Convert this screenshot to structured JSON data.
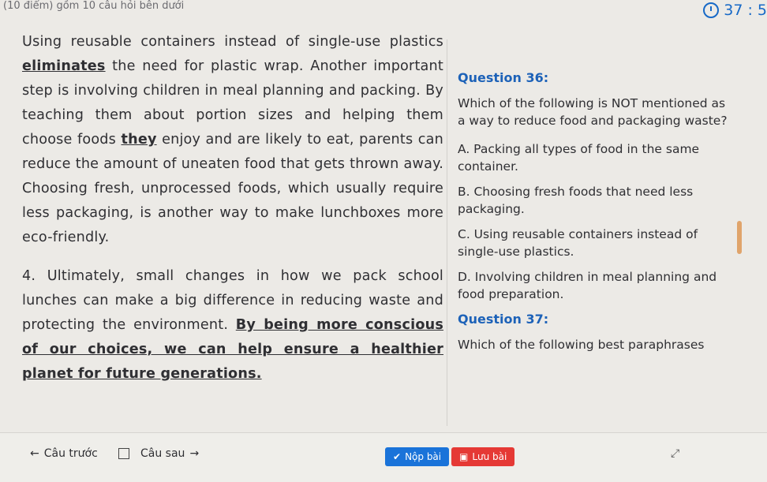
{
  "header": {
    "hint": "(10 điểm) gồm 10 câu hỏi bên dưới",
    "timer": "37 : 5"
  },
  "passage": {
    "p1_a": "Using reusable containers instead of single-use plastics ",
    "p1_u1": "eliminates",
    "p1_b": " the need for plastic wrap. Another important step is involving children in meal planning and packing. By teaching them about portion sizes and helping them choose foods ",
    "p1_u2": "they",
    "p1_c": " enjoy and are likely to eat, parents can reduce the amount of uneaten food that gets thrown away. Choosing fresh, unprocessed foods, which usually require less packaging, is another way to make lunchboxes more eco-friendly.",
    "p2_a": "4. Ultimately, small changes in how we pack school lunches can make a big difference in reducing waste and protecting the environment. ",
    "p2_u": "By being more conscious of our choices, we can help ensure a healthier planet for future generations."
  },
  "question36": {
    "title": "Question 36:",
    "text": "Which of the following is NOT mentioned as a way to reduce food and packaging waste?",
    "options": [
      "A. Packing all types of food in the same container.",
      "B. Choosing fresh foods that need less packaging.",
      "C. Using reusable containers instead of single-use plastics.",
      "D. Involving children in meal planning and food preparation."
    ]
  },
  "question37": {
    "title": "Question 37:",
    "text": "Which of the following best paraphrases"
  },
  "footer": {
    "prev": "Câu trước",
    "next": "Câu sau",
    "submit": "Nộp bài",
    "save": "Lưu bài"
  },
  "colors": {
    "accent": "#1769c7",
    "submit": "#1a73d9",
    "save": "#e53935"
  }
}
